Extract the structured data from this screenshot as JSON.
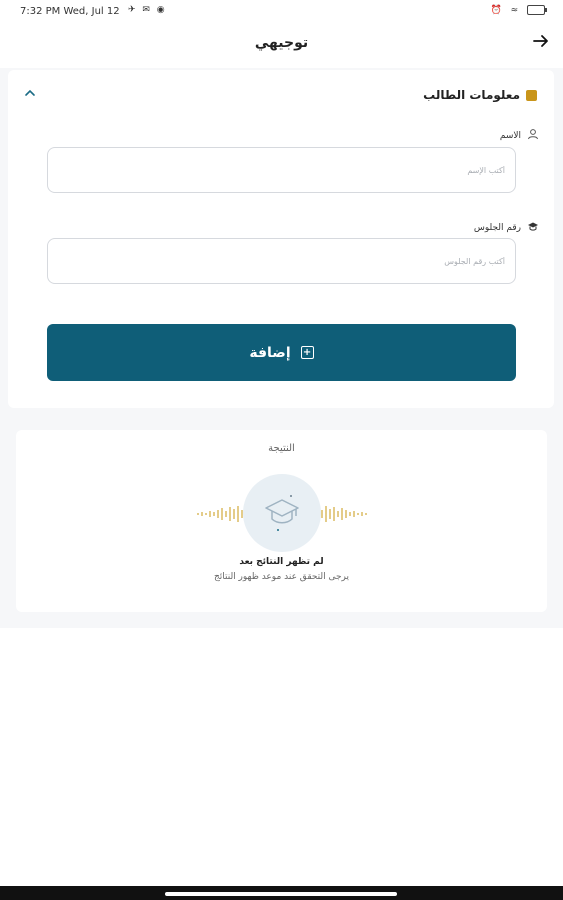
{
  "status_bar": {
    "time": "7:32 PM Wed, Jul 12",
    "left_icons": "✈ ✉ ◉",
    "right_icons": "⏰ ≈",
    "battery_icon": "battery-icon"
  },
  "app_bar": {
    "title": "توجيهي",
    "back_icon": "arrow-right-icon"
  },
  "student_section": {
    "title": "معلومات الطالب",
    "accent_color": "#c9951a",
    "collapse_icon": "chevron-up-icon",
    "name_field": {
      "label": "الاسم",
      "placeholder": "أكتب الإسم",
      "value": "",
      "icon": "person-icon"
    },
    "seat_field": {
      "label": "رقم الجلوس",
      "placeholder": "أكتب رقم الجلوس",
      "value": "",
      "icon": "graduation-cap-icon"
    },
    "add_button": {
      "label": "إضافة",
      "icon": "plus-square-icon",
      "color": "#0f5e78"
    }
  },
  "result_section": {
    "title": "النتيجة",
    "icon": "graduation-cap-icon",
    "message": "لم تظهر النتائج بعد",
    "sub_message": "يرجى التحقق عند موعد ظهور النتائج"
  }
}
